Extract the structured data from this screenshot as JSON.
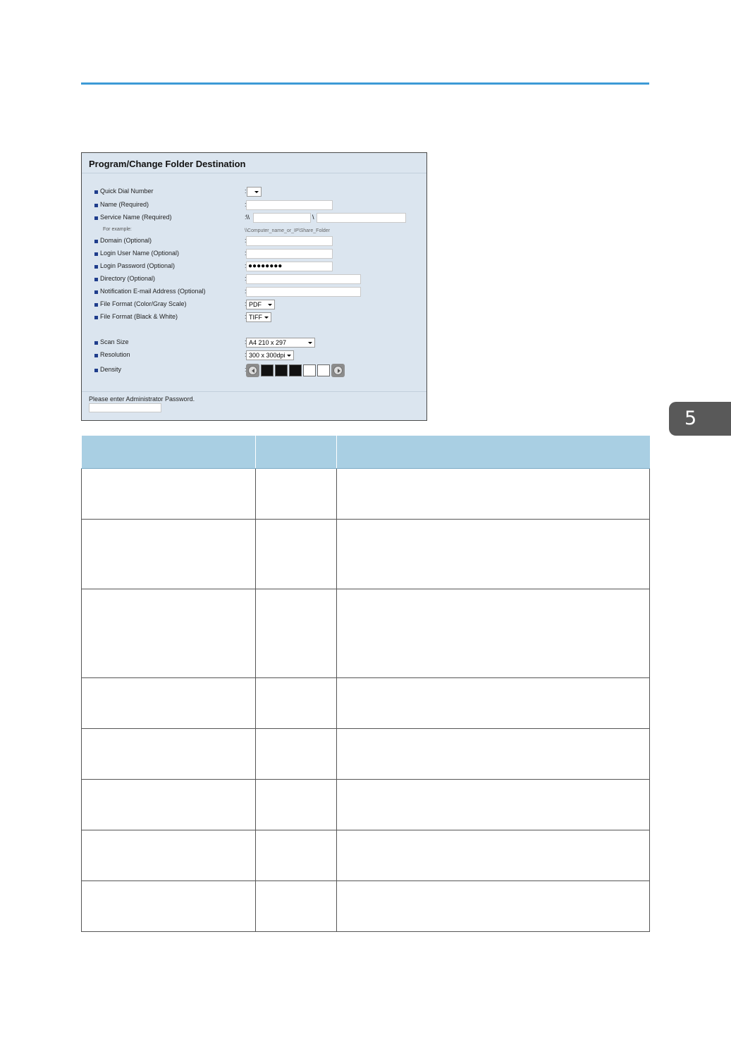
{
  "chapter_tab": "5",
  "panel": {
    "title": "Program/Change Folder Destination",
    "fields": [
      {
        "label": "Quick Dial Number"
      },
      {
        "label": "Name (Required)"
      },
      {
        "label": "Service Name (Required)"
      },
      {
        "label": "Domain (Optional)"
      },
      {
        "label": "Login User Name (Optional)"
      },
      {
        "label": "Login Password (Optional)"
      },
      {
        "label": "Directory (Optional)"
      },
      {
        "label": "Notification E-mail Address (Optional)"
      },
      {
        "label": "File Format (Color/Gray Scale)"
      },
      {
        "label": "File Format (Black & White)"
      },
      {
        "label": "Scan Size"
      },
      {
        "label": "Resolution"
      },
      {
        "label": "Density"
      }
    ],
    "colon": ":",
    "unc_prefix": "\\\\",
    "unc_separator": "\\",
    "example_label": "For example:",
    "example_value": "\\\\Computer_name_or_IP\\Share_Folder",
    "password_mask": "●●●●●●●●",
    "file_format_color": "PDF",
    "file_format_bw": "TIFF",
    "scan_size": "A4 210 x 297",
    "resolution": "300 x 300dpi",
    "density_level": 3,
    "density_steps": 5,
    "admin_prompt": "Please enter Administrator Password."
  },
  "table": {
    "row_count": 8
  }
}
